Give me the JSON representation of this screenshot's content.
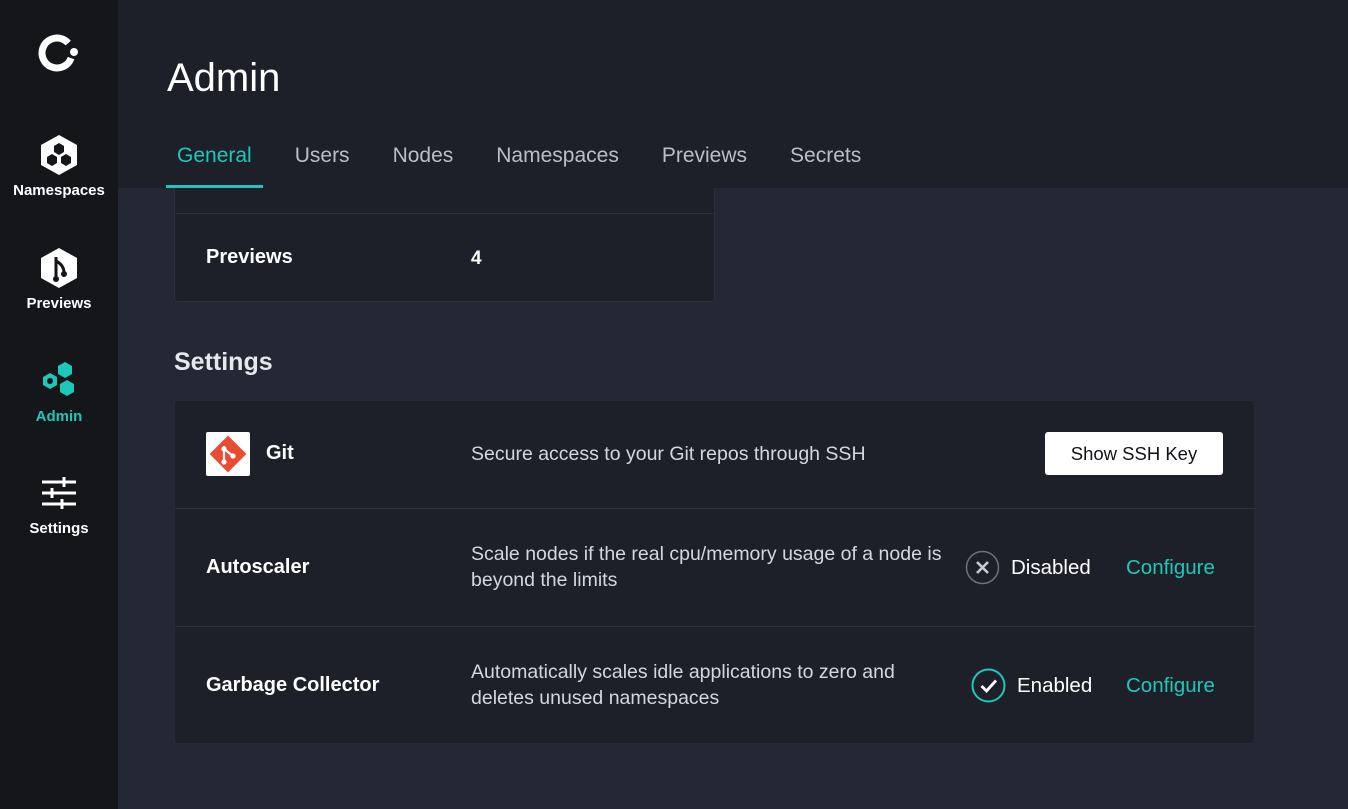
{
  "sidebar": {
    "logo_icon": "logo-c-icon",
    "items": [
      {
        "label": "Namespaces",
        "icon": "namespaces-hex-icon",
        "active": false
      },
      {
        "label": "Previews",
        "icon": "previews-branch-icon",
        "active": false
      },
      {
        "label": "Admin",
        "icon": "admin-hex-icon",
        "active": true
      },
      {
        "label": "Settings",
        "icon": "sliders-icon",
        "active": false
      }
    ]
  },
  "header": {
    "title": "Admin",
    "tabs": [
      {
        "label": "General",
        "active": true
      },
      {
        "label": "Users",
        "active": false
      },
      {
        "label": "Nodes",
        "active": false
      },
      {
        "label": "Namespaces",
        "active": false
      },
      {
        "label": "Previews",
        "active": false
      },
      {
        "label": "Secrets",
        "active": false
      }
    ]
  },
  "stats": {
    "previews_label": "Previews",
    "previews_value": "4"
  },
  "settings": {
    "title": "Settings",
    "git": {
      "name": "Git",
      "icon": "git-logo-icon",
      "description": "Secure access to your Git repos through SSH",
      "button_label": "Show SSH Key"
    },
    "autoscaler": {
      "name": "Autoscaler",
      "description": "Scale nodes if the real cpu/memory usage of a node is beyond the limits",
      "status_icon": "x-circle-icon",
      "status": "Disabled",
      "configure_label": "Configure"
    },
    "garbage_collector": {
      "name": "Garbage Collector",
      "description": "Automatically scales idle applications to zero and deletes unused namespaces",
      "status_icon": "check-circle-icon",
      "status": "Enabled",
      "configure_label": "Configure"
    }
  },
  "colors": {
    "accent": "#1ec8b8",
    "sidebar_bg": "#141619",
    "header_bg": "#1d2028",
    "page_bg": "#232834",
    "git_brand": "#e84d31"
  }
}
